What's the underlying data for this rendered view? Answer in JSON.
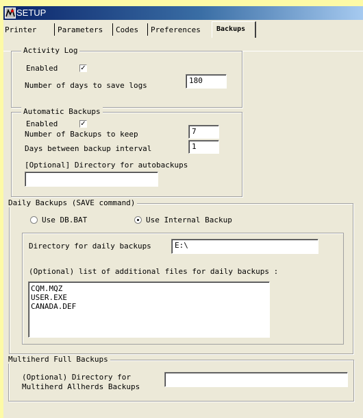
{
  "window": {
    "title": "SETUP"
  },
  "tabs": [
    {
      "label": "Printer"
    },
    {
      "label": "Parameters"
    },
    {
      "label": "Codes"
    },
    {
      "label": "Preferences"
    },
    {
      "label": "Backups",
      "active": true
    }
  ],
  "activity_log": {
    "title": "Activity Log",
    "enabled_label": "Enabled",
    "enabled_checked": true,
    "days_label": "Number of days to save logs",
    "days_value": "180"
  },
  "automatic_backups": {
    "title": "Automatic Backups",
    "enabled_label": "Enabled",
    "enabled_checked": true,
    "keep_label": "Number of Backups to keep",
    "keep_value": "7",
    "interval_label": "Days between backup interval",
    "interval_value": "1",
    "dir_label": "[Optional] Directory for autobackups",
    "dir_value": ""
  },
  "daily_backups": {
    "title": "Daily Backups (SAVE command)",
    "radio_dbbat_label": "Use DB.BAT",
    "radio_internal_label": "Use Internal Backup",
    "selected": "internal",
    "dir_label": "Directory for daily backups",
    "dir_value": "E:\\",
    "files_label": "(Optional) list of additional files for daily backups :",
    "files": [
      "CQM.MQZ",
      "USER.EXE",
      "CANADA.DEF"
    ]
  },
  "multiherd": {
    "title": "Multiherd Full Backups",
    "dir_label_line1": "(Optional) Directory for",
    "dir_label_line2": "Multiherd Allherds Backups",
    "dir_value": ""
  }
}
